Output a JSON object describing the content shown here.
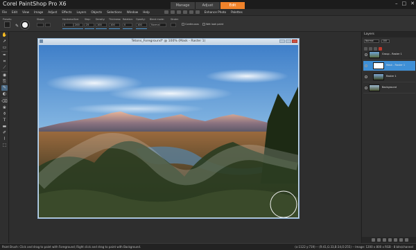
{
  "app": {
    "title": "Corel PaintShop Pro X6",
    "mode_tabs": [
      "Manage",
      "Adjust",
      "Edit"
    ],
    "active_tab": "Edit",
    "window_buttons": [
      "–",
      "□",
      "✕"
    ]
  },
  "menu": {
    "items": [
      "File",
      "Edit",
      "View",
      "Image",
      "Adjust",
      "Effects",
      "Layers",
      "Objects",
      "Selections",
      "Window",
      "Help"
    ],
    "enhance_photo": "Enhance Photo",
    "palettes": "Palettes"
  },
  "options": {
    "presets_label": "Presets:",
    "shape_label": "Shape:",
    "size_label": "Size:",
    "hardness_label": "Hardness:",
    "step_label": "Step:",
    "density_label": "Density:",
    "thickness_label": "Thickness:",
    "rotation_label": "Rotation:",
    "opacity_label": "Opacity:",
    "blend_label": "Blend mode:",
    "stroke_label": "Stroke:",
    "size_value": "200",
    "hardness_value": "0",
    "step_value": "25",
    "density_value": "100",
    "thickness_value": "100",
    "rotation_value": "0",
    "opacity_value": "100",
    "blend_value": "Normal",
    "continuous": "Continuous",
    "wet_look": "Wet look paint"
  },
  "image_window": {
    "title": "Tetons_Foreground* @ 100% (Mask - Raster 1)"
  },
  "layers": {
    "title": "Layers",
    "opacity_value": "100",
    "blend_value": "Normal",
    "rows": [
      {
        "name": "Group - Raster 1",
        "indent": 0,
        "active": false,
        "thumb": "sky"
      },
      {
        "name": "Mask - Raster 1",
        "indent": 1,
        "active": true,
        "thumb": "mask"
      },
      {
        "name": "Raster 1",
        "indent": 1,
        "active": false,
        "thumb": "photo"
      },
      {
        "name": "Background",
        "indent": 0,
        "active": false,
        "thumb": "photo"
      }
    ]
  },
  "status": {
    "left": "Paint Brush: Click and drag to paint with Foreground; Right click and drag to paint with Background.",
    "right": "(x:1122 y:719) -- (R:41,G:33,B:34,O:255) -- Image:  1200 x 800 x RGB - 8 bits/channel"
  }
}
